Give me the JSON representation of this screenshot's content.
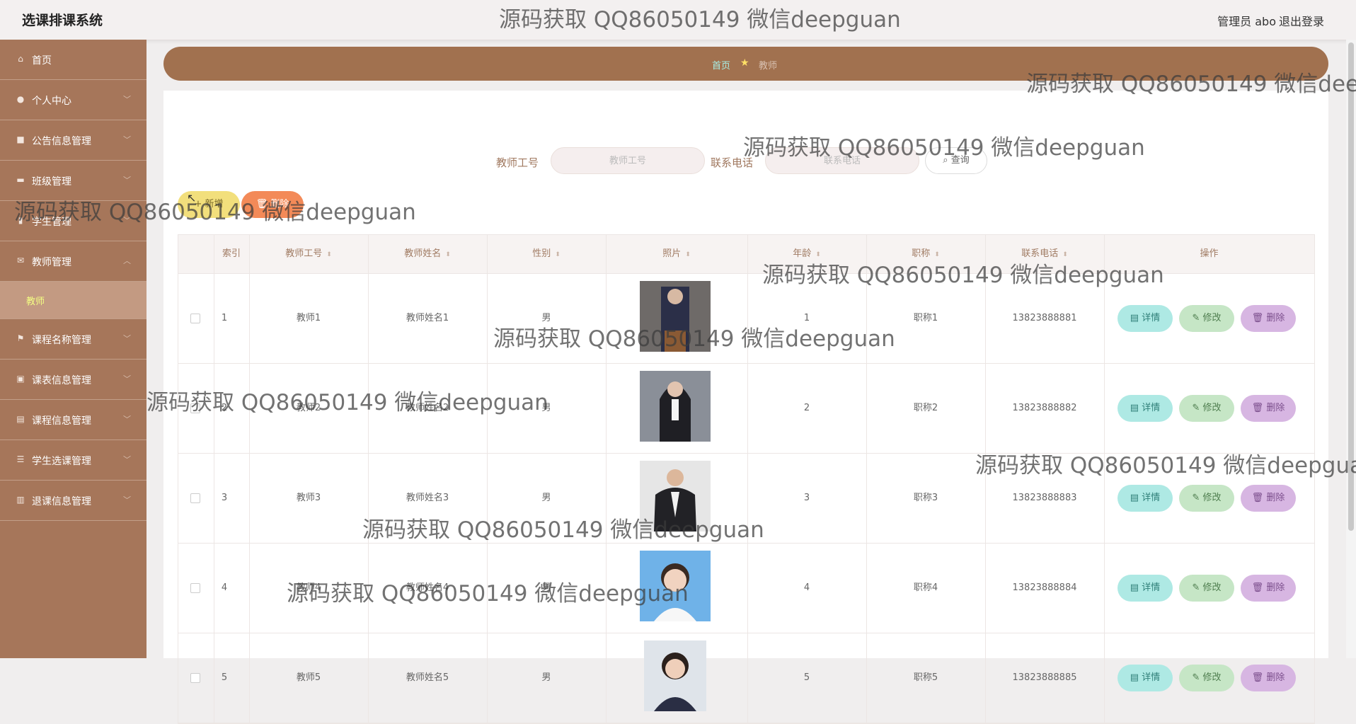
{
  "header": {
    "app_title": "选课排课系统",
    "user_info": "管理员 abo",
    "logout": "退出登录"
  },
  "sidebar": {
    "items": [
      {
        "label": "首页",
        "icon": "home-icon"
      },
      {
        "label": "个人中心",
        "icon": "user-icon"
      },
      {
        "label": "公告信息管理",
        "icon": "chat-icon"
      },
      {
        "label": "班级管理",
        "icon": "briefcase-icon"
      },
      {
        "label": "学生管理",
        "icon": "chart-icon"
      },
      {
        "label": "教师管理",
        "icon": "mail-icon"
      },
      {
        "label": "课程名称管理",
        "icon": "flag-icon"
      },
      {
        "label": "课表信息管理",
        "icon": "bag-icon"
      },
      {
        "label": "课程信息管理",
        "icon": "clipboard-icon"
      },
      {
        "label": "学生选课管理",
        "icon": "sliders-icon"
      },
      {
        "label": "退课信息管理",
        "icon": "book-icon"
      }
    ],
    "active_sub": "教师"
  },
  "breadcrumb": {
    "home": "首页",
    "current": "教师"
  },
  "search": {
    "label_id": "教师工号",
    "placeholder_id": "教师工号",
    "label_phone": "联系电话",
    "placeholder_phone": "联系电话",
    "query_label": "查询"
  },
  "actions": {
    "add_label": "新增",
    "delete_label": "删除"
  },
  "table": {
    "columns": [
      "索引",
      "教师工号",
      "教师姓名",
      "性别",
      "照片",
      "年龄",
      "职称",
      "联系电话",
      "操作"
    ],
    "rows": [
      {
        "index": "1",
        "id": "教师1",
        "name": "教师姓名1",
        "gender": "男",
        "age": "1",
        "title": "职称1",
        "phone": "13823888881"
      },
      {
        "index": "2",
        "id": "教师2",
        "name": "教师姓名2",
        "gender": "男",
        "age": "2",
        "title": "职称2",
        "phone": "13823888882"
      },
      {
        "index": "3",
        "id": "教师3",
        "name": "教师姓名3",
        "gender": "男",
        "age": "3",
        "title": "职称3",
        "phone": "13823888883"
      },
      {
        "index": "4",
        "id": "教师4",
        "name": "教师姓名4",
        "gender": "男",
        "age": "4",
        "title": "职称4",
        "phone": "13823888884"
      },
      {
        "index": "5",
        "id": "教师5",
        "name": "教师姓名5",
        "gender": "男",
        "age": "5",
        "title": "职称5",
        "phone": "13823888885"
      }
    ],
    "op_detail": "详情",
    "op_edit": "修改",
    "op_delete": "删除"
  },
  "watermark": "源码获取 QQ86050149 微信deepguan"
}
